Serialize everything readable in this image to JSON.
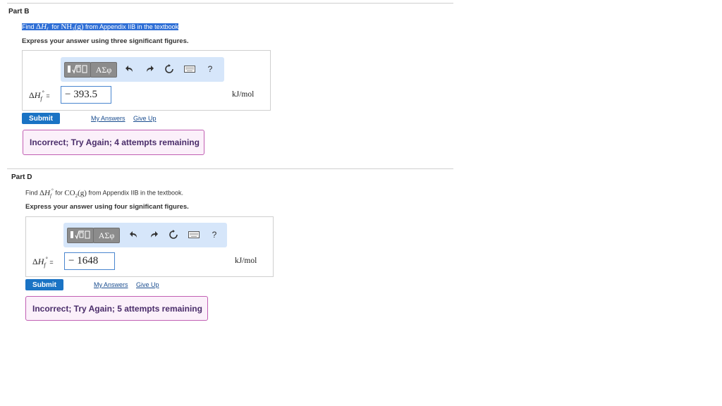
{
  "partB": {
    "title": "Part B",
    "question": {
      "prefix": "Find ",
      "delta": "Δ",
      "h": "H",
      "sub": "f",
      "sup": "°",
      "for": " for ",
      "compound": "NH",
      "compound_sub": "3",
      "phase": "(g)",
      "suffix": " from Appendix IIB in the textbook"
    },
    "instruction": "Express your answer using three significant figures.",
    "lhs_delta": "Δ",
    "lhs_h": "H",
    "lhs_sub": "f",
    "lhs_sup": "°",
    "lhs_eq": " =",
    "answer_value": "− 393.5",
    "unit": "kJ/mol",
    "submit_label": "Submit",
    "my_answers": "My Answers",
    "give_up": "Give Up",
    "feedback": "Incorrect; Try Again; 4 attempts remaining"
  },
  "partD": {
    "title": "Part D",
    "question": {
      "prefix": "Find ",
      "delta": "Δ",
      "h": "H",
      "sub": "f",
      "sup": "°",
      "for": " for ",
      "compound": "CO",
      "compound_sub": "2",
      "phase": "(g)",
      "suffix": " from Appendix IIB in the textbook."
    },
    "instruction": "Express your answer using four significant figures.",
    "lhs_delta": "Δ",
    "lhs_h": "H",
    "lhs_sub": "f",
    "lhs_sup": "°",
    "lhs_eq": " =",
    "answer_value": "− 1648",
    "unit": "kJ/mol",
    "submit_label": "Submit",
    "my_answers": "My Answers",
    "give_up": "Give Up",
    "feedback": "Incorrect; Try Again; 5 attempts remaining"
  },
  "toolbar": {
    "greek_label": "ΑΣφ",
    "help_label": "?",
    "template_icon": "templates-icon",
    "undo_icon": "undo-icon",
    "redo_icon": "redo-icon",
    "reset_icon": "reset-icon",
    "keyboard_icon": "keyboard-icon"
  },
  "colors": {
    "submit_bg": "#1a73c4",
    "toolbar_bg": "#d6e6fa",
    "feedback_border": "#c15fb3",
    "feedback_bg": "#fbf0fa",
    "highlight": "#2f6fd6"
  }
}
